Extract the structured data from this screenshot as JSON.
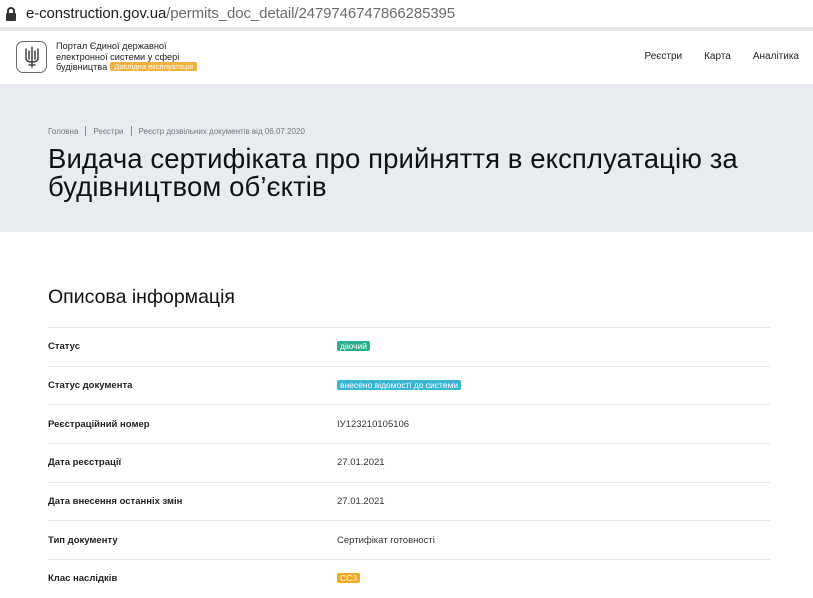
{
  "browser": {
    "url_domain": "e-construction.gov.ua",
    "url_path": "/permits_doc_detail/2479746747866285395"
  },
  "header": {
    "brand_line1": "Портал Єдиної державної",
    "brand_line2": "електронної системи у сфері",
    "brand_line3": "будівництва",
    "brand_badge": "Дослідна експлуатація",
    "nav": [
      "Реєстри",
      "Карта",
      "Аналітика"
    ]
  },
  "breadcrumb": [
    "Головна",
    "Реєстри",
    "Реєстр дозвільних документів від 06.07.2020"
  ],
  "page": {
    "title_line1": "Видача сертифіката про прийняття в експлуатацію за",
    "title_line2": "будівництвом об’єктів"
  },
  "section": {
    "title": "Описова інформація",
    "rows": [
      {
        "label": "Статус",
        "value": "діючий",
        "tag": "green"
      },
      {
        "label": "Статус документа",
        "value": "внесено відомості до системи",
        "tag": "blue"
      },
      {
        "label": "Реєстраційний номер",
        "value": "ІУ123210105106",
        "tag": ""
      },
      {
        "label": "Дата реєстрації",
        "value": "27.01.2021",
        "tag": ""
      },
      {
        "label": "Дата внесення останніх змін",
        "value": "27.01.2021",
        "tag": ""
      },
      {
        "label": "Тип документу",
        "value": "Сертифікат готовності",
        "tag": ""
      },
      {
        "label": "Клас наслідків",
        "value": "СС3",
        "tag": "orange"
      }
    ]
  },
  "colors": {
    "hero_bg": "#e8ecf1",
    "tag_green": "#2bb08f",
    "tag_blue": "#3ab6d6",
    "tag_orange": "#f2a91f",
    "badge_experimental": "#f2b13c"
  }
}
